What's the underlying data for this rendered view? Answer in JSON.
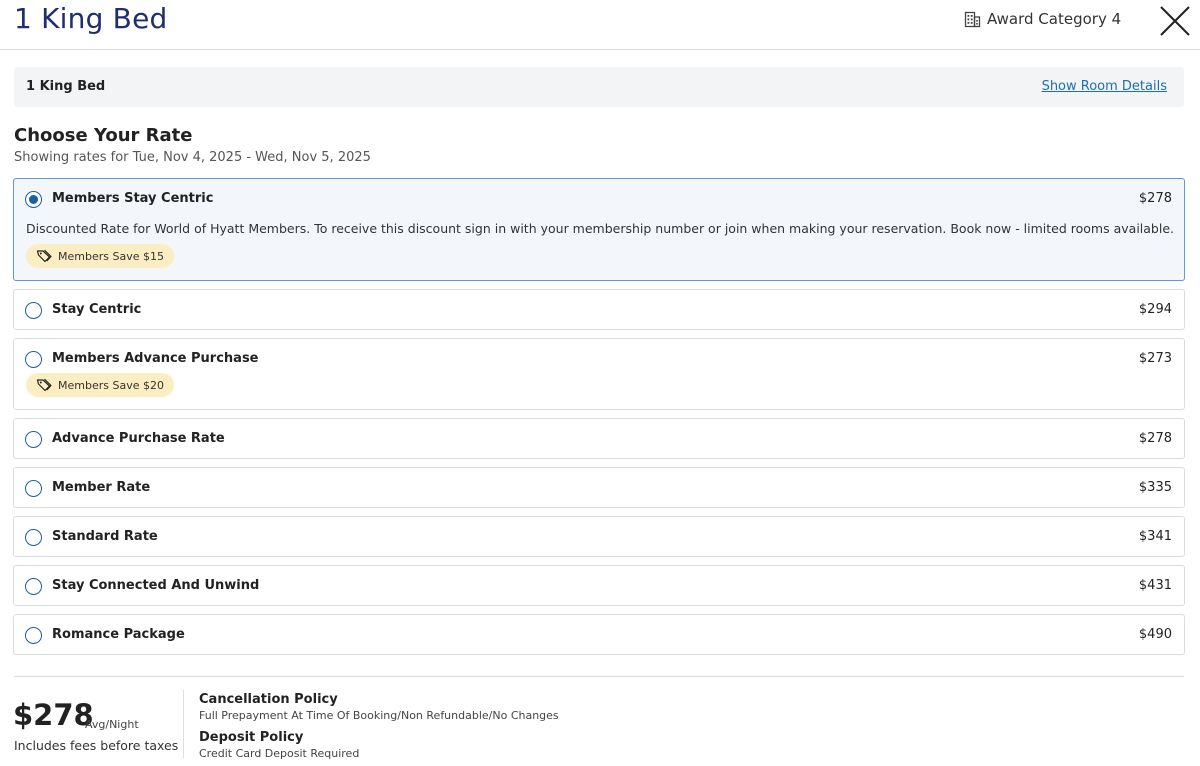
{
  "header": {
    "title": "1 King Bed",
    "award": "Award Category 4",
    "close_icon": "close-icon",
    "award_icon": "building-icon"
  },
  "room_bar": {
    "label": "1 King Bed",
    "link": "Show Room Details"
  },
  "rates_section": {
    "title": "Choose Your Rate",
    "subtitle": "Showing rates for Tue, Nov 4, 2025 - Wed, Nov 5, 2025"
  },
  "rates": [
    {
      "name": "Members Stay Centric",
      "price": "$278",
      "selected": true,
      "description": "Discounted Rate for World of Hyatt Members. To receive this discount sign in with your membership number or join when making your reservation. Book now - limited rooms available.",
      "badge": "Members Save $15"
    },
    {
      "name": "Stay Centric",
      "price": "$294"
    },
    {
      "name": "Members Advance Purchase",
      "price": "$273",
      "badge": "Members Save $20"
    },
    {
      "name": "Advance Purchase Rate",
      "price": "$278"
    },
    {
      "name": "Member Rate",
      "price": "$335"
    },
    {
      "name": "Standard Rate",
      "price": "$341"
    },
    {
      "name": "Stay Connected And Unwind",
      "price": "$431"
    },
    {
      "name": "Romance Package",
      "price": "$490"
    }
  ],
  "summary": {
    "price": "$278",
    "per_night": "Avg/Night",
    "fees_note": "Includes fees before taxes",
    "cancellation_title": "Cancellation Policy",
    "cancellation_text": "Full Prepayment At Time Of Booking/Non Refundable/No Changes",
    "deposit_title": "Deposit Policy",
    "deposit_text": "Credit Card Deposit Required"
  },
  "colors": {
    "title": "#1f2f6b",
    "accent": "#1a5fa8",
    "selected_border": "#5b9bd5",
    "badge_bg": "#fcedc2"
  }
}
